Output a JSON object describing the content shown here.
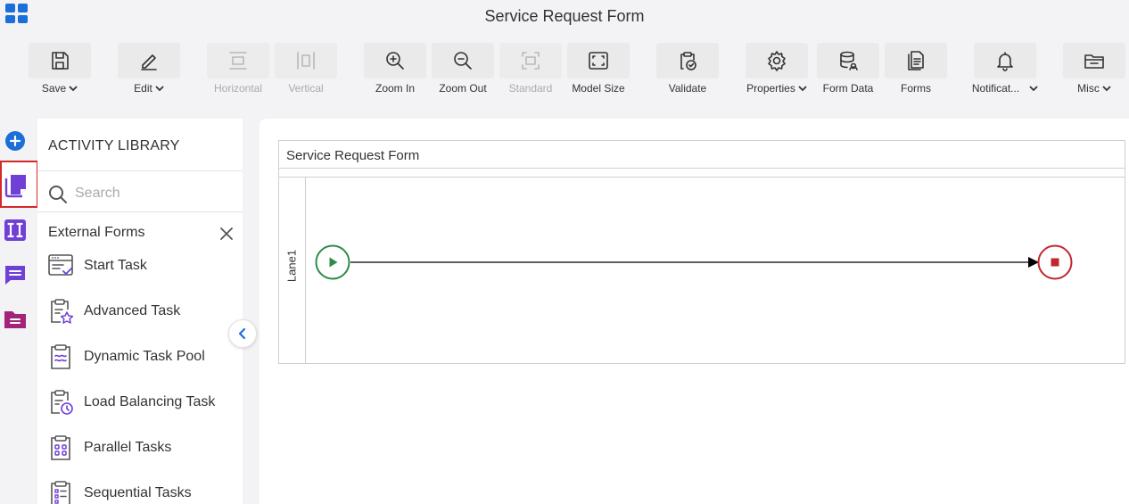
{
  "header": {
    "title": "Service Request Form"
  },
  "toolbar": {
    "save": "Save",
    "edit": "Edit",
    "horizontal": "Horizontal",
    "vertical": "Vertical",
    "zoom_in": "Zoom In",
    "zoom_out": "Zoom Out",
    "standard": "Standard",
    "model_size": "Model Size",
    "validate": "Validate",
    "properties": "Properties",
    "form_data": "Form Data",
    "forms": "Forms",
    "notifications": "Notificat...",
    "misc": "Misc"
  },
  "library": {
    "title": "ACTIVITY LIBRARY",
    "search_placeholder": "Search",
    "section": "External Forms",
    "items": [
      {
        "label": "Start Task",
        "icon": "start-task-icon"
      },
      {
        "label": "Advanced Task",
        "icon": "advanced-task-icon"
      },
      {
        "label": "Dynamic Task Pool",
        "icon": "dynamic-task-pool-icon"
      },
      {
        "label": "Load Balancing Task",
        "icon": "load-balancing-task-icon"
      },
      {
        "label": "Parallel Tasks",
        "icon": "parallel-tasks-icon"
      },
      {
        "label": "Sequential Tasks",
        "icon": "sequential-tasks-icon"
      }
    ]
  },
  "canvas": {
    "pool_title": "Service Request Form",
    "lane_label": "Lane1"
  },
  "colors": {
    "accent": "#1a6fd8",
    "purple": "#6f3fd6",
    "magenta": "#a3237a",
    "start_event": "#2e8b47",
    "end_event": "#c0282e",
    "selection": "#d62828"
  }
}
